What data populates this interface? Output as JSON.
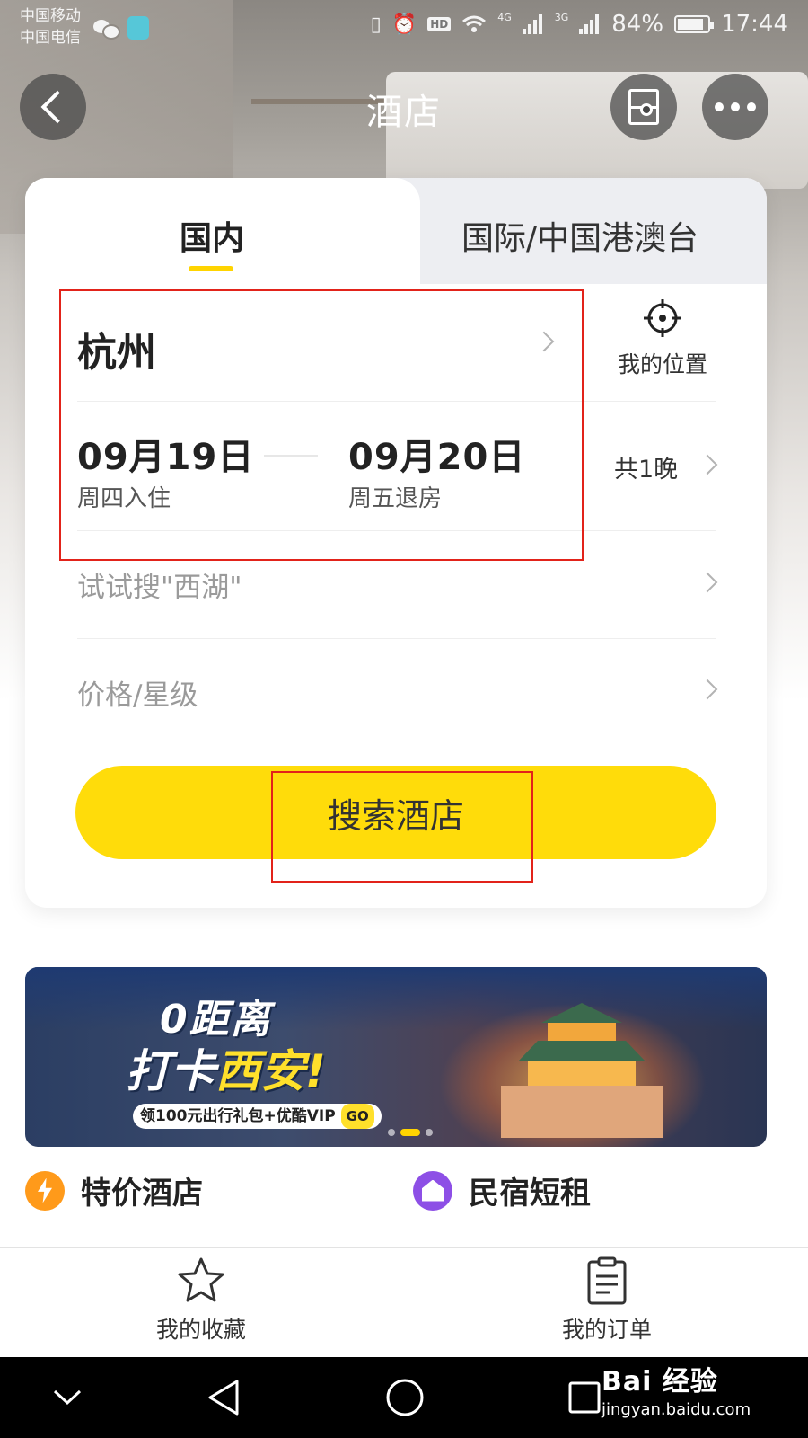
{
  "status_bar": {
    "carrier_1": "中国移动",
    "carrier_2": "中国电信",
    "battery": "84%",
    "time": "17:44",
    "net_4g": "4G",
    "net_3g": "3G",
    "hd": "HD",
    "icons": [
      "wechat-icon",
      "shield-icon",
      "vibrate-icon",
      "alarm-icon",
      "wifi-icon",
      "signal-icon",
      "battery-icon"
    ]
  },
  "header": {
    "title": "酒店",
    "back_icon": "chevron-left-icon",
    "scan_icon": "scan-icon",
    "more_icon": "more-icon"
  },
  "tabs": [
    {
      "label": "国内",
      "active": true
    },
    {
      "label": "国际/中国港澳台",
      "active": false
    }
  ],
  "search_form": {
    "city": "杭州",
    "location_label": "我的位置",
    "check_in_date": "09月19日",
    "check_in_label": "周四入住",
    "check_out_date": "09月20日",
    "check_out_label": "周五退房",
    "nights": "共1晚",
    "keyword_placeholder": "试试搜\"西湖\"",
    "price_star_placeholder": "价格/星级",
    "search_button": "搜索酒店"
  },
  "banner": {
    "title_line1": "0距离",
    "title_line2_a": "打卡",
    "title_line2_b": "西安!",
    "subtitle": "领100元出行礼包+优酷VIP",
    "go": "GO",
    "slide_count": 3,
    "active_slide": 2
  },
  "quick_entries": [
    {
      "label": "特价酒店",
      "icon": "bolt-icon",
      "color": "#ff9a1a"
    },
    {
      "label": "民宿短租",
      "icon": "home-icon",
      "color": "#8d4fe6"
    }
  ],
  "bottom_bar": [
    {
      "label": "我的收藏",
      "icon": "star-icon"
    },
    {
      "label": "我的订单",
      "icon": "doc-icon"
    }
  ],
  "watermark": {
    "main": "Bai 经验",
    "url": "jingyan.baidu.com"
  },
  "colors": {
    "accent_yellow": "#ffdc0a",
    "highlight_red": "#e2231a"
  }
}
